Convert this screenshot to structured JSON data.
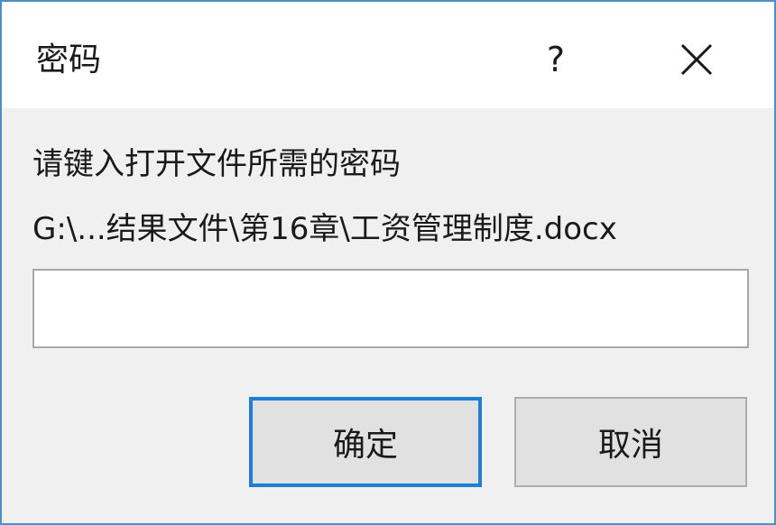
{
  "dialog": {
    "title": "密码",
    "help_label": "?",
    "close_icon": "close-icon"
  },
  "content": {
    "prompt": "请键入打开文件所需的密码",
    "file_path": "G:\\...结果文件\\第16章\\工资管理制度.docx",
    "password_value": ""
  },
  "buttons": {
    "ok_label": "确定",
    "cancel_label": "取消"
  },
  "colors": {
    "accent": "#1e7fd6",
    "window_border": "#4a8fd0",
    "dialog_bg": "#f0f0f0",
    "button_bg": "#e1e1e1"
  }
}
